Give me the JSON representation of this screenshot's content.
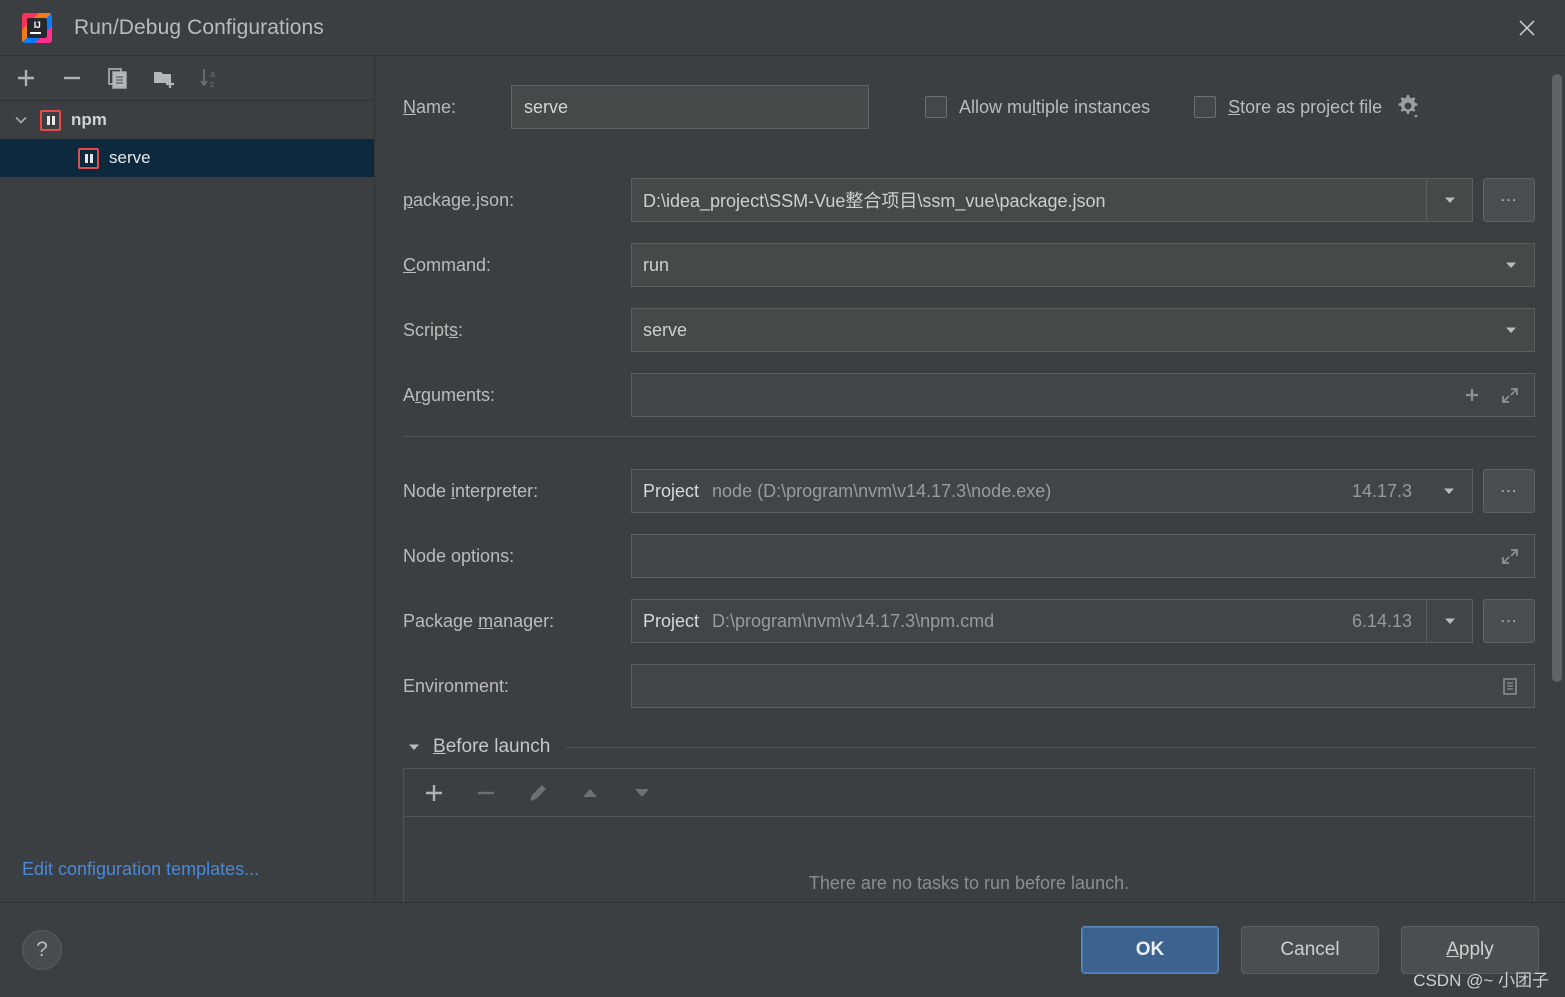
{
  "window": {
    "title": "Run/Debug Configurations",
    "logo_text": "IJ",
    "close_icon": "close-icon"
  },
  "tree_toolbar": [
    {
      "name": "add-configuration-button",
      "icon": "plus-icon",
      "enabled": true
    },
    {
      "name": "remove-configuration-button",
      "icon": "minus-icon",
      "enabled": true
    },
    {
      "name": "copy-configuration-button",
      "icon": "copy-icon",
      "enabled": true
    },
    {
      "name": "new-folder-button",
      "icon": "folder-add-icon",
      "enabled": true
    },
    {
      "name": "sort-configurations-button",
      "icon": "sort-az-icon",
      "enabled": false
    }
  ],
  "tree": {
    "group_label": "npm",
    "items": [
      {
        "label": "serve",
        "selected": true
      }
    ]
  },
  "edit_templates_link": "Edit configuration templates...",
  "form": {
    "name": {
      "label": "Name:",
      "mnemonic": "N",
      "value": "serve",
      "placeholder": ""
    },
    "allow_multiple_instances": {
      "label_before": "Allow mu",
      "mnemonic": "l",
      "label_after": "tiple instances",
      "checked": false
    },
    "store_as_project_file": {
      "mnemonic": "S",
      "label_after": "tore as project file",
      "checked": false,
      "gear_icon": "gear-icon"
    },
    "package_json": {
      "label_before": "",
      "mnemonic": "p",
      "label_after": "ackage.json:",
      "value": "D:\\idea_project\\SSM-Vue整合项目\\ssm_vue\\package.json",
      "browse_label": "..."
    },
    "command": {
      "mnemonic": "C",
      "label_after": "ommand:",
      "value": "run"
    },
    "scripts": {
      "label_before": "Script",
      "mnemonic": "s",
      "label_after": ":",
      "value": "serve"
    },
    "arguments": {
      "label_before": "A",
      "mnemonic": "r",
      "label_after": "guments:",
      "value": "",
      "icons": [
        "plus-icon",
        "expand-icon"
      ]
    },
    "node_interpreter": {
      "label_before": "Node ",
      "mnemonic": "i",
      "label_after": "nterpreter:",
      "scope": "Project",
      "value": "node (D:\\program\\nvm\\v14.17.3\\node.exe)",
      "version": "14.17.3",
      "browse_label": "..."
    },
    "node_options": {
      "label": "Node options:",
      "value": "",
      "icons": [
        "expand-icon"
      ]
    },
    "package_manager": {
      "label_before": "Package ",
      "mnemonic": "m",
      "label_after": "anager:",
      "scope": "Project",
      "value": "D:\\program\\nvm\\v14.17.3\\npm.cmd",
      "version": "6.14.13",
      "browse_label": "..."
    },
    "environment": {
      "label": "Environment:",
      "value": "",
      "icons": [
        "list-icon"
      ]
    }
  },
  "before_launch": {
    "mnemonic": "B",
    "label_after": "efore launch",
    "twisty": "chevron-down-icon",
    "toolbar": [
      {
        "name": "add-task-button",
        "icon": "plus-icon",
        "enabled": true
      },
      {
        "name": "remove-task-button",
        "icon": "minus-icon",
        "enabled": false
      },
      {
        "name": "edit-task-button",
        "icon": "pencil-icon",
        "enabled": false
      },
      {
        "name": "move-task-up-button",
        "icon": "arrow-up-icon",
        "enabled": false
      },
      {
        "name": "move-task-down-button",
        "icon": "arrow-down-icon",
        "enabled": false
      }
    ],
    "empty_text": "There are no tasks to run before launch."
  },
  "footer": {
    "help_label": "?",
    "ok_label": "OK",
    "cancel_label": "Cancel",
    "apply_mnemonic": "A",
    "apply_label_after": "pply"
  },
  "watermark": "CSDN @~ 小团子",
  "colors": {
    "background": "#3c3f41",
    "field_background": "#45494a",
    "selection": "#0d293e",
    "link": "#4a88d8",
    "accent_button": "#3c628f",
    "npm_icon_border": "#e84a4a"
  }
}
